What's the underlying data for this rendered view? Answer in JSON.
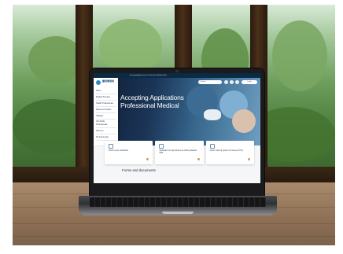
{
  "site": {
    "topbar_text": "Accepting Applications for Professional Medical Staff",
    "logo_text": "醫院管理局",
    "hero_title_line1": "Accepting Applications",
    "hero_title_line2": "Professional Medical",
    "search_label": "Search",
    "pill_label": "Login",
    "nav_items": [
      "Home",
      "Medical Services",
      "Health Professionals",
      "Patients & Visitors",
      "Charges",
      "Our Public Professionals",
      "About us",
      "HA Community"
    ],
    "cards": [
      {
        "label": "Doctor Letter Verification"
      },
      {
        "label": "Application for Appointment as Visiting Medical Staff"
      },
      {
        "label": "Online Training System for Nurses (OTN)"
      }
    ],
    "forms_title": "Forms and documents"
  },
  "colors": {
    "hero_dark": "#0f1c33",
    "hero_light": "#6e9fc2",
    "topbar": "#0b2a44",
    "accent": "#c7a14a"
  }
}
